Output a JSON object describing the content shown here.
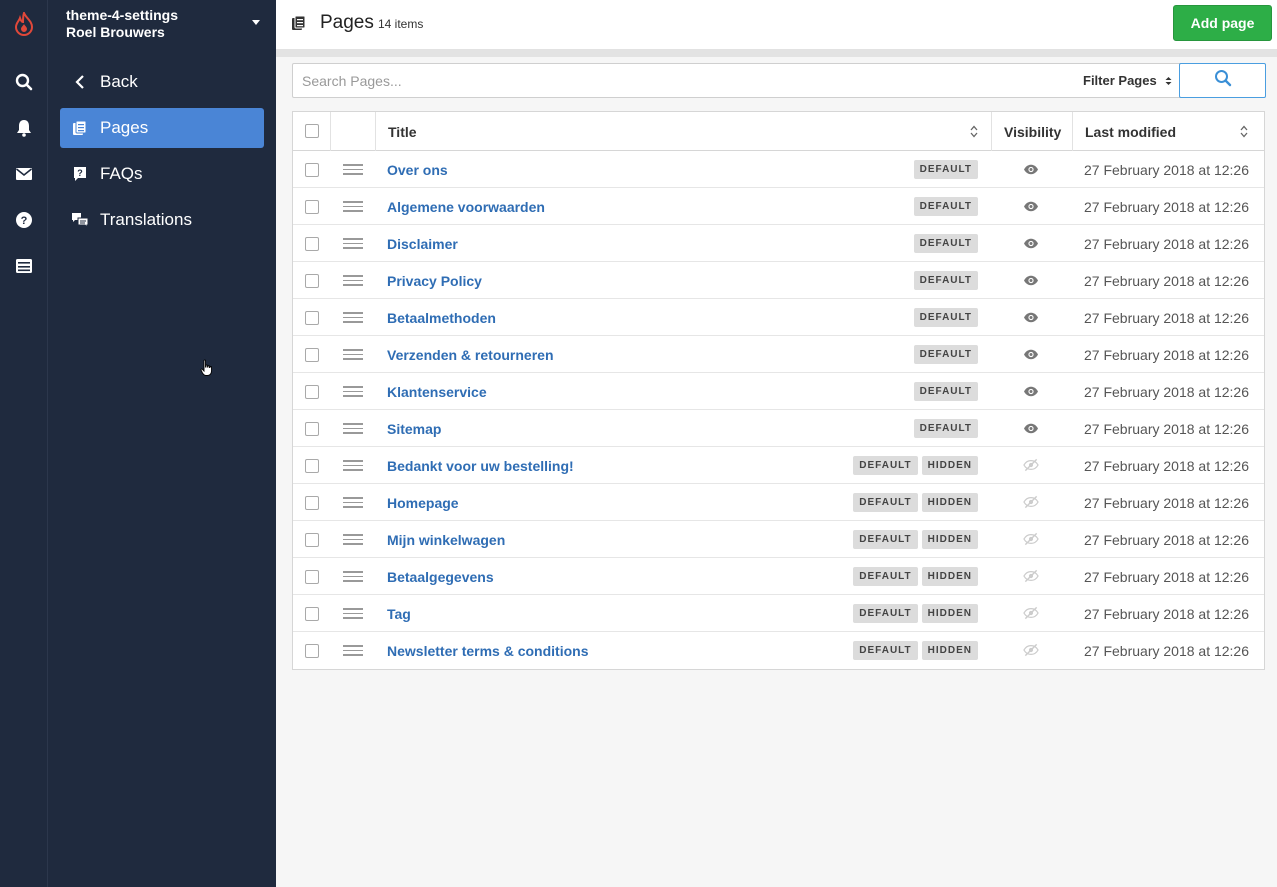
{
  "sidebar": {
    "shop_name": "theme-4-settings",
    "user_name": "Roel Brouwers",
    "back_label": "Back",
    "items": [
      {
        "label": "Pages",
        "icon": "pages-icon",
        "active": true
      },
      {
        "label": "FAQs",
        "icon": "faq-icon",
        "active": false
      },
      {
        "label": "Translations",
        "icon": "translations-icon",
        "active": false
      }
    ]
  },
  "rail": {
    "icons": [
      "logo-icon",
      "search-icon",
      "bell-icon",
      "mail-icon",
      "help-icon",
      "store-icon"
    ],
    "accent": "#e0483a"
  },
  "header": {
    "title": "Pages",
    "count": "14 items",
    "add_label": "Add page",
    "add_color": "#2dae47"
  },
  "search": {
    "placeholder": "Search Pages...",
    "filter_label": "Filter Pages"
  },
  "table": {
    "columns": {
      "title": "Title",
      "visibility": "Visibility",
      "modified": "Last modified"
    },
    "rows": [
      {
        "title": "Over ons",
        "badges": [
          "DEFAULT"
        ],
        "visible": true,
        "modified": "27 February 2018 at 12:26"
      },
      {
        "title": "Algemene voorwaarden",
        "badges": [
          "DEFAULT"
        ],
        "visible": true,
        "modified": "27 February 2018 at 12:26"
      },
      {
        "title": "Disclaimer",
        "badges": [
          "DEFAULT"
        ],
        "visible": true,
        "modified": "27 February 2018 at 12:26"
      },
      {
        "title": "Privacy Policy",
        "badges": [
          "DEFAULT"
        ],
        "visible": true,
        "modified": "27 February 2018 at 12:26"
      },
      {
        "title": "Betaalmethoden",
        "badges": [
          "DEFAULT"
        ],
        "visible": true,
        "modified": "27 February 2018 at 12:26"
      },
      {
        "title": "Verzenden & retourneren",
        "badges": [
          "DEFAULT"
        ],
        "visible": true,
        "modified": "27 February 2018 at 12:26"
      },
      {
        "title": "Klantenservice",
        "badges": [
          "DEFAULT"
        ],
        "visible": true,
        "modified": "27 February 2018 at 12:26"
      },
      {
        "title": "Sitemap",
        "badges": [
          "DEFAULT"
        ],
        "visible": true,
        "modified": "27 February 2018 at 12:26"
      },
      {
        "title": "Bedankt voor uw bestelling!",
        "badges": [
          "DEFAULT",
          "HIDDEN"
        ],
        "visible": false,
        "modified": "27 February 2018 at 12:26"
      },
      {
        "title": "Homepage",
        "badges": [
          "DEFAULT",
          "HIDDEN"
        ],
        "visible": false,
        "modified": "27 February 2018 at 12:26"
      },
      {
        "title": "Mijn winkelwagen",
        "badges": [
          "DEFAULT",
          "HIDDEN"
        ],
        "visible": false,
        "modified": "27 February 2018 at 12:26"
      },
      {
        "title": "Betaalgegevens",
        "badges": [
          "DEFAULT",
          "HIDDEN"
        ],
        "visible": false,
        "modified": "27 February 2018 at 12:26"
      },
      {
        "title": "Tag",
        "badges": [
          "DEFAULT",
          "HIDDEN"
        ],
        "visible": false,
        "modified": "27 February 2018 at 12:26"
      },
      {
        "title": "Newsletter terms & conditions",
        "badges": [
          "DEFAULT",
          "HIDDEN"
        ],
        "visible": false,
        "modified": "27 February 2018 at 12:26"
      }
    ]
  }
}
